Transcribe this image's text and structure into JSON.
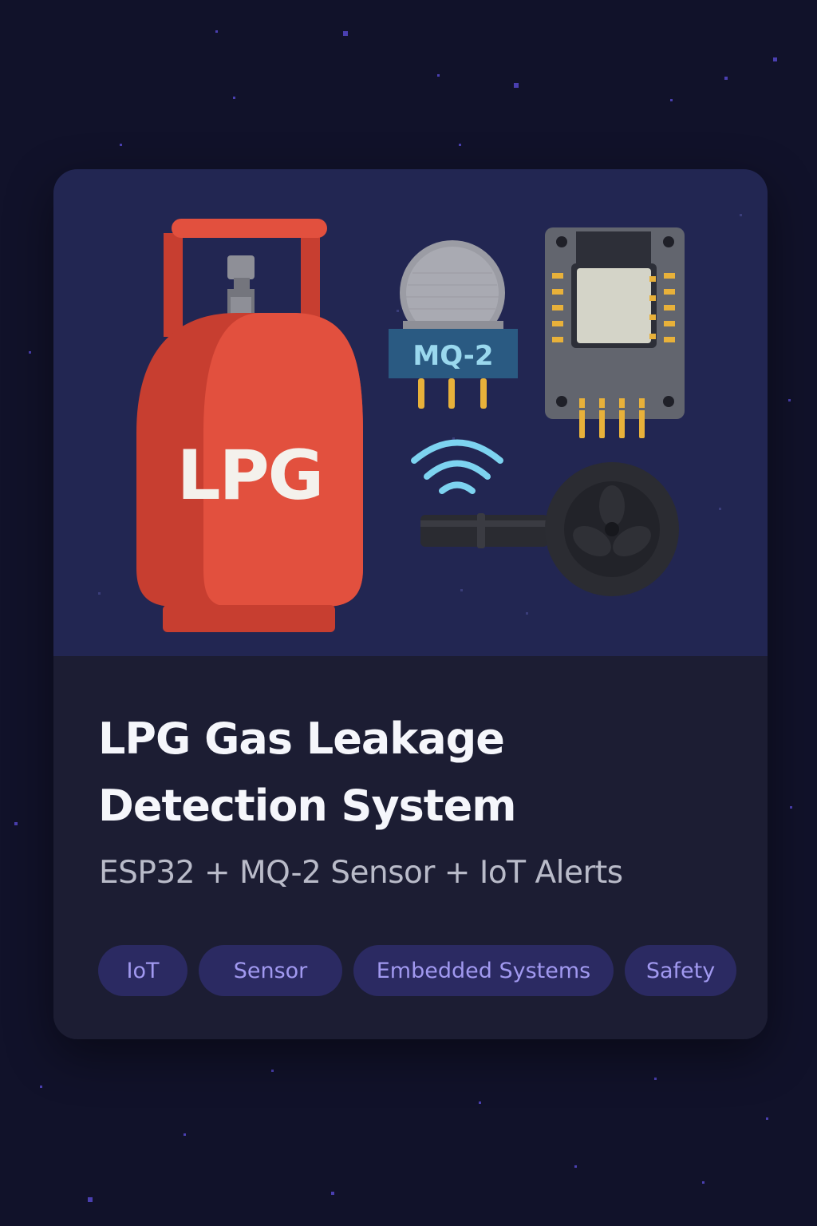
{
  "card": {
    "illustration": {
      "cylinder_label": "LPG",
      "sensor_label": "MQ-2",
      "icons": [
        "lpg-cylinder-icon",
        "mq2-sensor-icon",
        "esp32-board-icon",
        "wifi-icon",
        "exhaust-fan-icon"
      ]
    },
    "title": "LPG Gas Leakage Detection System",
    "subtitle": "ESP32 + MQ-2 Sensor + IoT Alerts",
    "tags": [
      "IoT",
      "Sensor",
      "Embedded Systems",
      "Safety"
    ]
  },
  "colors": {
    "background": "#11122a",
    "hero_background": "#222652",
    "content_background": "#1c1d33",
    "title_text": "#f5f6fb",
    "subtitle_text": "#b9bbc9",
    "tag_background": "#2b2a62",
    "tag_text": "#a199f0",
    "cylinder_red": "#e2503e",
    "wifi_blue": "#7dd3f0"
  }
}
